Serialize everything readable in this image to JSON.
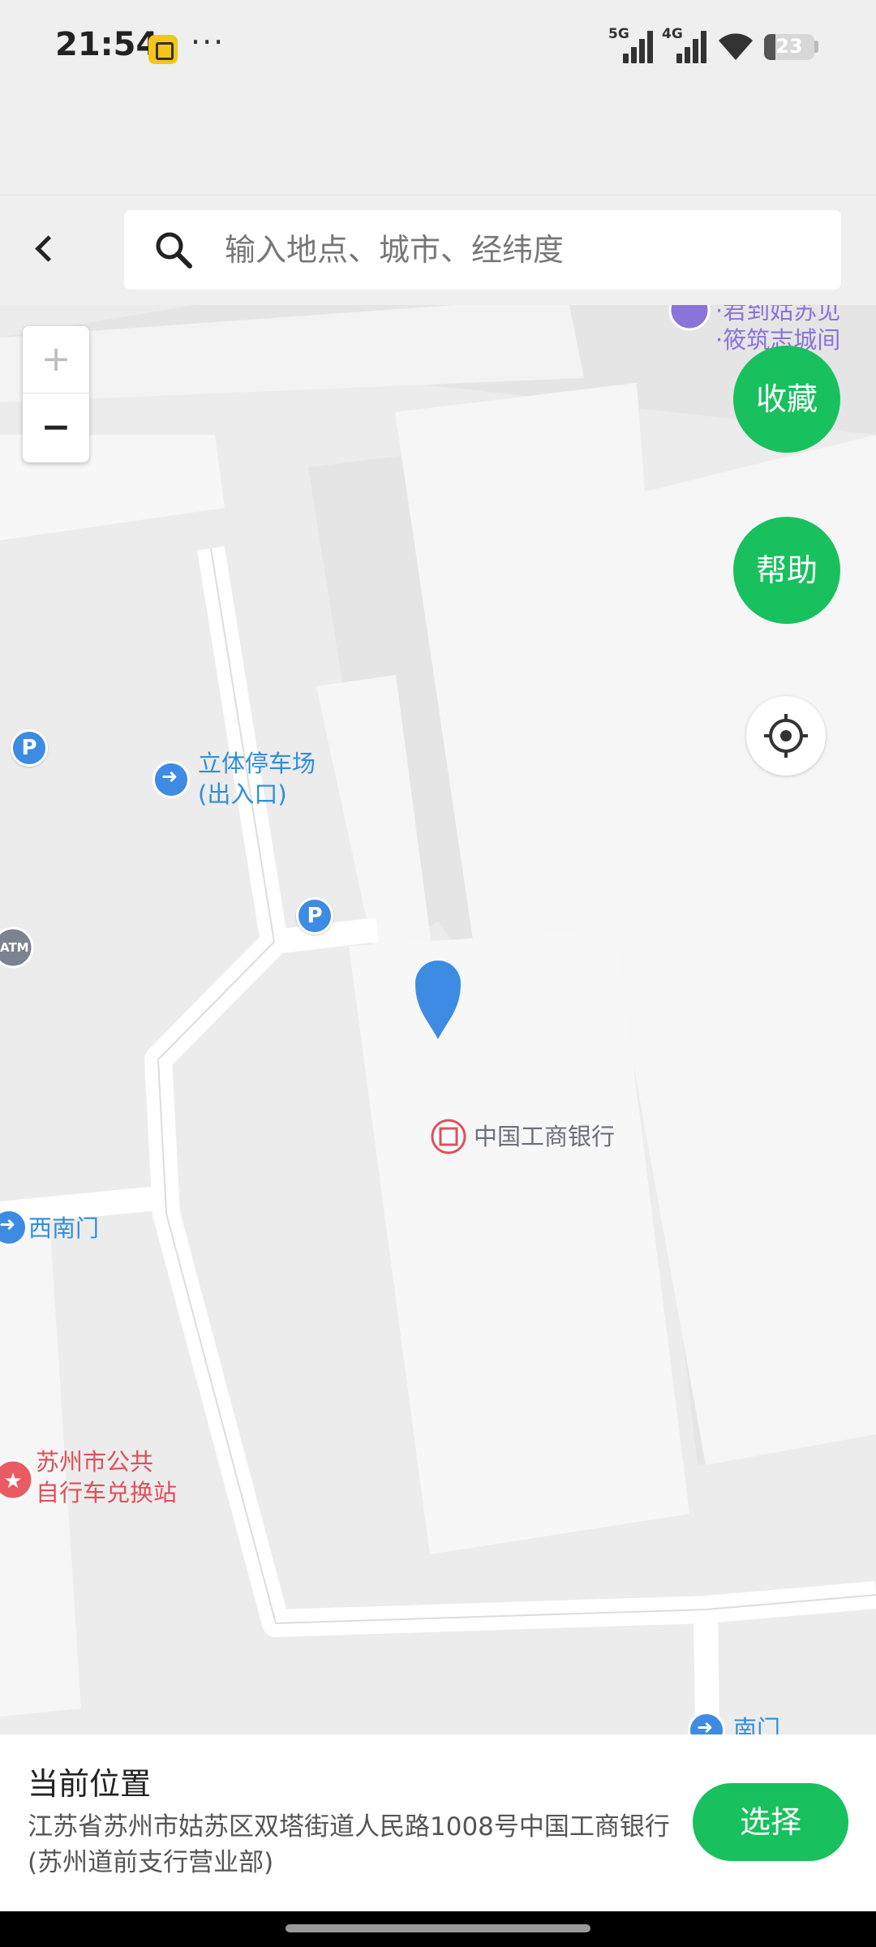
{
  "status_bar": {
    "time": "21:54",
    "more": "···",
    "signal_1_label": "5G",
    "signal_2_label": "4G",
    "battery_percent": "23",
    "battery_level": 0.23
  },
  "header": {
    "search_placeholder": "输入地点、城市、经纬度"
  },
  "map": {
    "zoom_in_label": "+",
    "zoom_out_label": "−",
    "favorite_label": "收藏",
    "help_label": "帮助",
    "pois": {
      "hotel_line_1": "·君到姑苏见",
      "hotel_line_2": "·筱筑志城间",
      "parking_garage_line_1": "立体停车场",
      "parking_garage_line_2": "(出入口)",
      "parking_symbol": "P",
      "atm": "ATM",
      "bank": "中国工商银行",
      "southwest_gate": "西南门",
      "bike_station_line_1": "苏州市公共",
      "bike_station_line_2": "自行车兑换站",
      "south_gate": "南门"
    }
  },
  "bottom_panel": {
    "title": "当前位置",
    "address": "江苏省苏州市姑苏区双塔街道人民路1008号中国工商银行(苏州道前支行营业部)",
    "select_label": "选择"
  },
  "colors": {
    "accent_green": "#19c05e",
    "pin_blue": "#3d8be3",
    "poi_blue": "#2f8ed8",
    "poi_red": "#e0505a"
  }
}
